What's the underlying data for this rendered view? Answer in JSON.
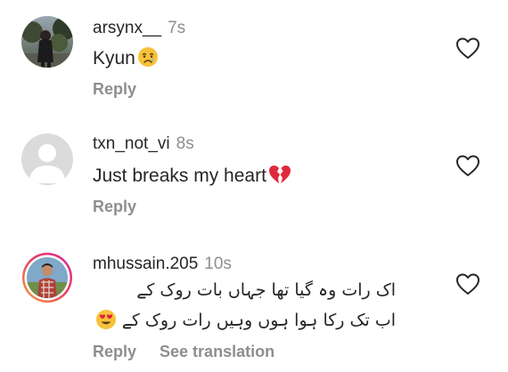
{
  "comments": [
    {
      "username": "arsynx__",
      "time": "7s",
      "text": "Kyun",
      "emoji": "crying-face",
      "reply_label": "Reply",
      "avatar": "user-photo-avatar",
      "like_icon": "heart-outline-icon"
    },
    {
      "username": "txn_not_vi",
      "time": "8s",
      "text": "Just breaks my heart",
      "emoji": "broken-heart",
      "reply_label": "Reply",
      "avatar": "default-avatar",
      "like_icon": "heart-outline-icon"
    },
    {
      "username": "mhussain.205",
      "time": "10s",
      "text_lines": [
        "اک رات وہ گیا تھا جہاں بات روک کے",
        "اب تک رکا ہوا ہوں وہیں رات روک کے"
      ],
      "emoji": "heart-eyes",
      "reply_label": "Reply",
      "see_translation_label": "See translation",
      "avatar": "story-ring-avatar",
      "like_icon": "heart-outline-icon"
    }
  ],
  "colors": {
    "text": "#262626",
    "secondary": "#8e8e8e",
    "story_ring_start": "#f9a33a",
    "story_ring_end": "#d6249f"
  }
}
